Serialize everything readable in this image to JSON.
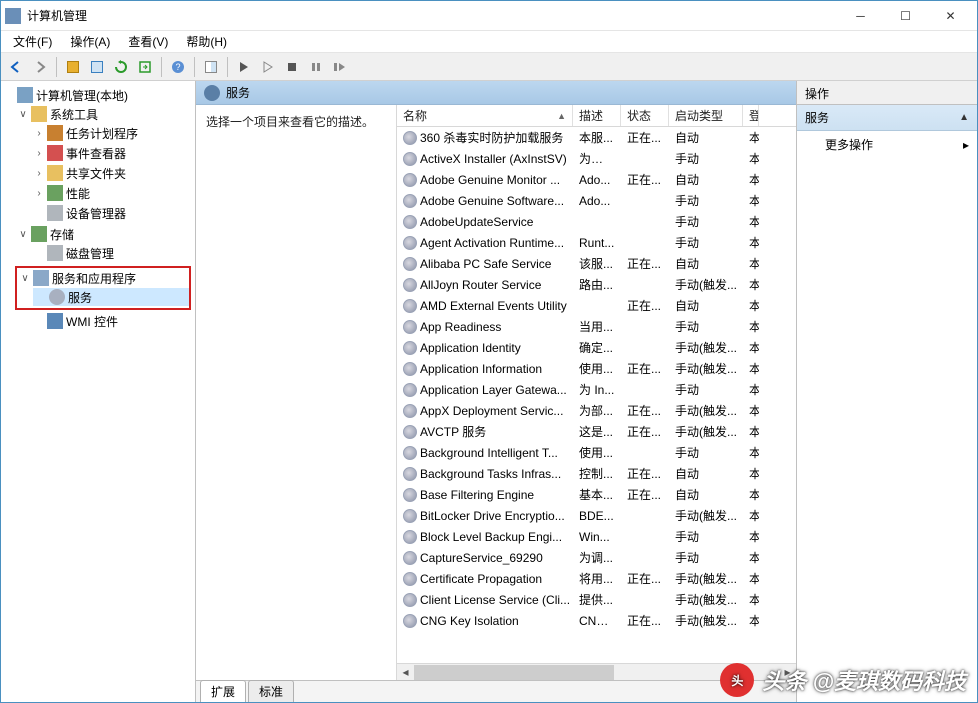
{
  "window": {
    "title": "计算机管理"
  },
  "menu": {
    "file": "文件(F)",
    "action": "操作(A)",
    "view": "查看(V)",
    "help": "帮助(H)"
  },
  "tree": {
    "root": "计算机管理(本地)",
    "sys_tools": "系统工具",
    "task_sched": "任务计划程序",
    "event_viewer": "事件查看器",
    "shared_folders": "共享文件夹",
    "perf": "性能",
    "dev_mgr": "设备管理器",
    "storage": "存储",
    "disk_mgmt": "磁盘管理",
    "svc_apps": "服务和应用程序",
    "services": "服务",
    "wmi": "WMI 控件"
  },
  "center": {
    "header": "服务",
    "desc_prompt": "选择一个项目来查看它的描述。",
    "cols": {
      "name": "名称",
      "desc": "描述",
      "status": "状态",
      "stype": "启动类型",
      "logon": "登"
    },
    "tabs": {
      "extended": "扩展",
      "standard": "标准"
    }
  },
  "right": {
    "header": "操作",
    "sec1": "服务",
    "more": "更多操作"
  },
  "services": [
    {
      "name": "360 杀毒实时防护加载服务",
      "desc": "本服...",
      "status": "正在...",
      "stype": "自动",
      "logon": "本"
    },
    {
      "name": "ActiveX Installer (AxInstSV)",
      "desc": "为从 ...",
      "status": "",
      "stype": "手动",
      "logon": "本"
    },
    {
      "name": "Adobe Genuine Monitor ...",
      "desc": "Ado...",
      "status": "正在...",
      "stype": "自动",
      "logon": "本"
    },
    {
      "name": "Adobe Genuine Software...",
      "desc": "Ado...",
      "status": "",
      "stype": "手动",
      "logon": "本"
    },
    {
      "name": "AdobeUpdateService",
      "desc": "",
      "status": "",
      "stype": "手动",
      "logon": "本"
    },
    {
      "name": "Agent Activation Runtime...",
      "desc": "Runt...",
      "status": "",
      "stype": "手动",
      "logon": "本"
    },
    {
      "name": "Alibaba PC Safe Service",
      "desc": "该服...",
      "status": "正在...",
      "stype": "自动",
      "logon": "本"
    },
    {
      "name": "AllJoyn Router Service",
      "desc": "路由...",
      "status": "",
      "stype": "手动(触发...",
      "logon": "本"
    },
    {
      "name": "AMD External Events Utility",
      "desc": "",
      "status": "正在...",
      "stype": "自动",
      "logon": "本"
    },
    {
      "name": "App Readiness",
      "desc": "当用...",
      "status": "",
      "stype": "手动",
      "logon": "本"
    },
    {
      "name": "Application Identity",
      "desc": "确定...",
      "status": "",
      "stype": "手动(触发...",
      "logon": "本"
    },
    {
      "name": "Application Information",
      "desc": "使用...",
      "status": "正在...",
      "stype": "手动(触发...",
      "logon": "本"
    },
    {
      "name": "Application Layer Gatewa...",
      "desc": "为 In...",
      "status": "",
      "stype": "手动",
      "logon": "本"
    },
    {
      "name": "AppX Deployment Servic...",
      "desc": "为部...",
      "status": "正在...",
      "stype": "手动(触发...",
      "logon": "本"
    },
    {
      "name": "AVCTP 服务",
      "desc": "这是...",
      "status": "正在...",
      "stype": "手动(触发...",
      "logon": "本"
    },
    {
      "name": "Background Intelligent T...",
      "desc": "使用...",
      "status": "",
      "stype": "手动",
      "logon": "本"
    },
    {
      "name": "Background Tasks Infras...",
      "desc": "控制...",
      "status": "正在...",
      "stype": "自动",
      "logon": "本"
    },
    {
      "name": "Base Filtering Engine",
      "desc": "基本...",
      "status": "正在...",
      "stype": "自动",
      "logon": "本"
    },
    {
      "name": "BitLocker Drive Encryptio...",
      "desc": "BDE...",
      "status": "",
      "stype": "手动(触发...",
      "logon": "本"
    },
    {
      "name": "Block Level Backup Engi...",
      "desc": "Win...",
      "status": "",
      "stype": "手动",
      "logon": "本"
    },
    {
      "name": "CaptureService_69290",
      "desc": "为调...",
      "status": "",
      "stype": "手动",
      "logon": "本"
    },
    {
      "name": "Certificate Propagation",
      "desc": "将用...",
      "status": "正在...",
      "stype": "手动(触发...",
      "logon": "本"
    },
    {
      "name": "Client License Service (Cli...",
      "desc": "提供...",
      "status": "",
      "stype": "手动(触发...",
      "logon": "本"
    },
    {
      "name": "CNG Key Isolation",
      "desc": "CNG...",
      "status": "正在...",
      "stype": "手动(触发...",
      "logon": "本"
    }
  ],
  "watermark": "头条 @麦琪数码科技"
}
